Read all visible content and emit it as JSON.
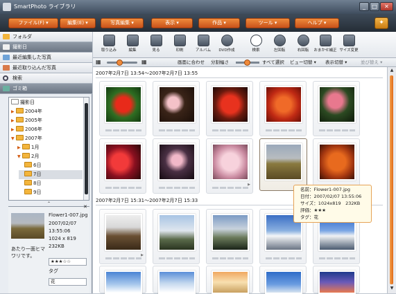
{
  "window": {
    "title": "SmartPhoto ライブラリ"
  },
  "menu": [
    {
      "label": "ファイル(F) ▾"
    },
    {
      "label": "編集(E) ▾"
    },
    {
      "label": "写真編集 ▾"
    },
    {
      "label": "表示 ▾"
    },
    {
      "label": "作品 ▾"
    },
    {
      "label": "ツール ▾"
    },
    {
      "label": "ヘルプ ▾"
    }
  ],
  "sidebar": {
    "nav": [
      {
        "label": "フォルダ"
      },
      {
        "label": "撮影日"
      },
      {
        "label": "最近編集した写真"
      },
      {
        "label": "最近取り込んだ写真"
      },
      {
        "label": "検索"
      },
      {
        "label": "ゴミ箱"
      }
    ],
    "tree": [
      {
        "label": "撮影日",
        "arrow": ""
      },
      {
        "label": "2004年",
        "arrow": "▶"
      },
      {
        "label": "2005年",
        "arrow": "▶"
      },
      {
        "label": "2006年",
        "arrow": "▶"
      },
      {
        "label": "2007年",
        "arrow": "▼"
      },
      {
        "label": "1月",
        "arrow": "▶"
      },
      {
        "label": "2月",
        "arrow": "▼"
      },
      {
        "label": "6日",
        "arrow": ""
      },
      {
        "label": "7日",
        "arrow": ""
      },
      {
        "label": "8日",
        "arrow": ""
      },
      {
        "label": "9日",
        "arrow": ""
      }
    ]
  },
  "info": {
    "filename": "Flower1-007.jpg",
    "date": "2007/02/07",
    "time": "13:55:06",
    "size": "1024 x 819",
    "filesize": "232KB",
    "caption": "あたり一面ヒマワリです。",
    "rating": "★★★☆☆",
    "tag_label": "タグ",
    "tag_value": "花"
  },
  "toolbar": [
    {
      "label": "取り込み"
    },
    {
      "label": "編集"
    },
    {
      "label": "見る"
    },
    {
      "label": "印刷"
    },
    {
      "label": "アルバム"
    },
    {
      "label": "DVD作成"
    },
    {
      "label": "検索"
    },
    {
      "label": "左回転"
    },
    {
      "label": "右回転"
    },
    {
      "label": "おまかせ補正"
    },
    {
      "label": "サイズ変更"
    }
  ],
  "subtoolbar": {
    "fit": "画面に合わせ",
    "split": "分割幅さ",
    "select_all": "すべて選択",
    "view_switch": "ビュー切替 ▾",
    "display_switch": "表示切替 ▾",
    "sort": "並び替え ▾"
  },
  "groups": [
    {
      "header": "2007年2月7日 13:54〜2007年2月7日 13:55"
    },
    {
      "header": "2007年2月7日 15:31〜2007年2月7日 15:33"
    }
  ],
  "tooltip": {
    "name": "名前：Flower1-007.jpg",
    "date": "日付：2007/02/07 13:55:06",
    "size": "サイズ：1024x819　232KB",
    "rating": "評価：★★★",
    "tag": "タグ：花"
  },
  "colors": {
    "accent": "#e8732a",
    "menubar": "#2f3842",
    "selection": "#8a7a66"
  }
}
